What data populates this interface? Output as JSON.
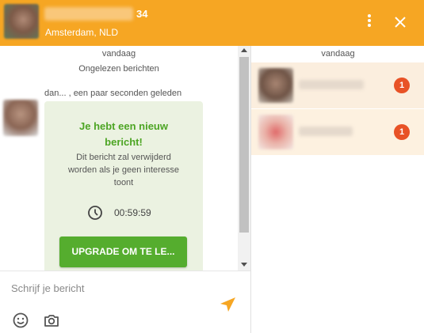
{
  "header": {
    "age": "34",
    "location": "Amsterdam, NLD",
    "accent_color": "#f6a623",
    "icons": {
      "menu": "more-vertical-icon",
      "close": "close-icon"
    }
  },
  "chat": {
    "day_label": "vandaag",
    "unread_label": "Ongelezen berichten",
    "message_meta": "dan... , een paar seconden geleden",
    "message": {
      "title_line1": "Je hebt een nieuw",
      "title_line2": "bericht!",
      "body_line1": "Dit bericht zal verwijderd",
      "body_line2": "worden als je geen interesse",
      "body_line3": "toont",
      "timer": "00:59:59",
      "upgrade_label": "UPGRADE OM TE LE..."
    },
    "colors": {
      "bubble": "#ebf2e1",
      "title": "#4da524",
      "button": "#55ad2e"
    }
  },
  "composer": {
    "placeholder": "Schrijf je bericht",
    "value": "",
    "icons": {
      "send": "send-icon",
      "emoji": "emoji-icon",
      "camera": "camera-icon"
    }
  },
  "conversations": {
    "day_label": "vandaag",
    "items": [
      {
        "badge": "1"
      },
      {
        "badge": "1"
      }
    ],
    "badge_color": "#e85226"
  }
}
